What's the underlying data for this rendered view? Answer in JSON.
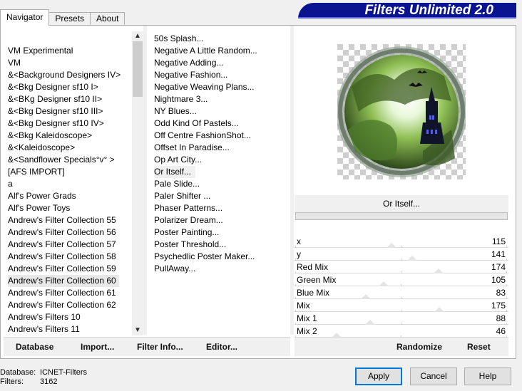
{
  "tabs": [
    "Navigator",
    "Presets",
    "About"
  ],
  "banner_title": "Filters Unlimited 2.0",
  "categories": [
    {
      "label": " VM Experimental",
      "selected": false
    },
    {
      "label": " VM",
      "selected": false
    },
    {
      "label": "&<Background Designers IV>",
      "selected": false
    },
    {
      "label": "&<Bkg Designer sf10 I>",
      "selected": false
    },
    {
      "label": "&<BKg Designer sf10 II>",
      "selected": false
    },
    {
      "label": "&<Bkg Designer sf10 III>",
      "selected": false
    },
    {
      "label": "&<Bkg Designer sf10 IV>",
      "selected": false
    },
    {
      "label": "&<Bkg Kaleidoscope>",
      "selected": false
    },
    {
      "label": "&<Kaleidoscope>",
      "selected": false
    },
    {
      "label": "&<Sandflower Specials°v° >",
      "selected": false
    },
    {
      "label": "[AFS IMPORT]",
      "selected": false
    },
    {
      "label": "a",
      "selected": false
    },
    {
      "label": "Alf's Power Grads",
      "selected": false
    },
    {
      "label": "Alf's Power Toys",
      "selected": false
    },
    {
      "label": "Andrew's Filter Collection 55",
      "selected": false
    },
    {
      "label": "Andrew's Filter Collection 56",
      "selected": false
    },
    {
      "label": "Andrew's Filter Collection 57",
      "selected": false
    },
    {
      "label": "Andrew's Filter Collection 58",
      "selected": false
    },
    {
      "label": "Andrew's Filter Collection 59",
      "selected": false
    },
    {
      "label": "Andrew's Filter Collection 60",
      "selected": true
    },
    {
      "label": "Andrew's Filter Collection 61",
      "selected": false
    },
    {
      "label": "Andrew's Filter Collection 62",
      "selected": false
    },
    {
      "label": "Andrew's Filters 10",
      "selected": false
    },
    {
      "label": "Andrew's Filters 11",
      "selected": false
    }
  ],
  "filters": [
    {
      "label": "50s Splash...",
      "selected": false
    },
    {
      "label": "Negative A Little Random...",
      "selected": false
    },
    {
      "label": "Negative Adding...",
      "selected": false
    },
    {
      "label": "Negative Fashion...",
      "selected": false
    },
    {
      "label": "Negative Weaving Plans...",
      "selected": false
    },
    {
      "label": "Nightmare 3...",
      "selected": false
    },
    {
      "label": "NY Blues...",
      "selected": false
    },
    {
      "label": "Odd Kind Of Pastels...",
      "selected": false
    },
    {
      "label": "Off Centre FashionShot...",
      "selected": false
    },
    {
      "label": "Offset In Paradise...",
      "selected": false
    },
    {
      "label": "Op Art City...",
      "selected": false
    },
    {
      "label": "Or Itself...",
      "selected": true
    },
    {
      "label": "Pale Slide...",
      "selected": false
    },
    {
      "label": "Paler Shifter ...",
      "selected": false
    },
    {
      "label": "Phaser Patterns...",
      "selected": false
    },
    {
      "label": "Polarizer Dream...",
      "selected": false
    },
    {
      "label": "Poster Painting...",
      "selected": false
    },
    {
      "label": "Poster Threshold...",
      "selected": false
    },
    {
      "label": "Psychedlic Poster Maker...",
      "selected": false
    },
    {
      "label": "PullAway...",
      "selected": false
    }
  ],
  "current_filter": "Or Itself...",
  "parameters": [
    {
      "label": "x",
      "value": 115,
      "max": 255
    },
    {
      "label": "y",
      "value": 141,
      "max": 255
    },
    {
      "label": "Red Mix",
      "value": 174,
      "max": 255
    },
    {
      "label": "Green Mix",
      "value": 105,
      "max": 255
    },
    {
      "label": "Blue Mix",
      "value": 83,
      "max": 255
    },
    {
      "label": "Mix",
      "value": 175,
      "max": 255
    },
    {
      "label": "Mix 1",
      "value": 88,
      "max": 255
    },
    {
      "label": "Mix 2",
      "value": 46,
      "max": 255
    }
  ],
  "left_buttons": {
    "database": "Database",
    "import": "Import...",
    "filter_info": "Filter Info...",
    "editor": "Editor..."
  },
  "right_buttons": {
    "randomize": "Randomize",
    "reset": "Reset"
  },
  "status": {
    "database_label": "Database:",
    "database_value": "ICNET-Filters",
    "filters_label": "Filters:",
    "filters_value": "3162"
  },
  "dialog_buttons": {
    "apply": "Apply",
    "cancel": "Cancel",
    "help": "Help"
  },
  "colors": {
    "banner": "#0a1491",
    "focus": "#0078d7"
  }
}
